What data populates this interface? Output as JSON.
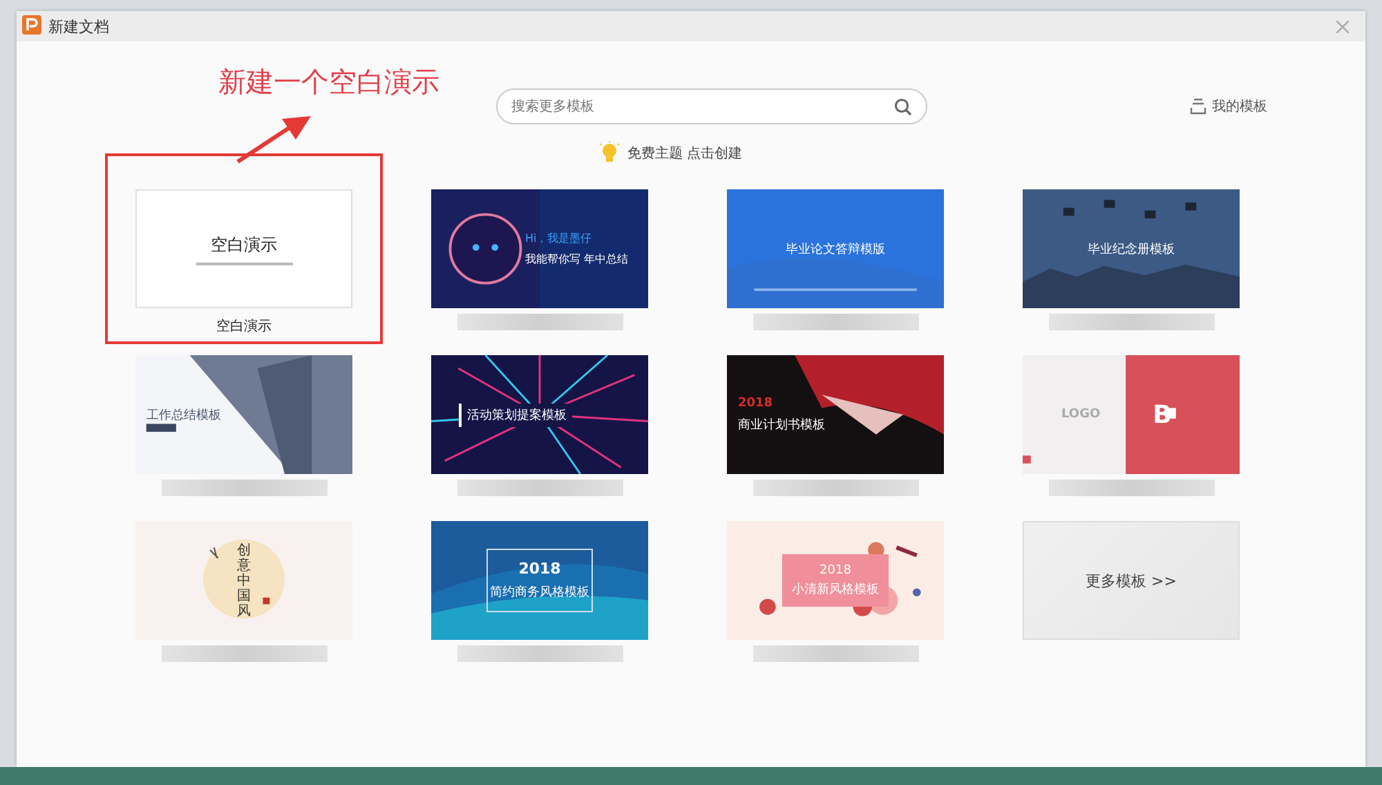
{
  "window": {
    "title": "新建文档"
  },
  "annotation": {
    "text": "新建一个空白演示"
  },
  "search": {
    "placeholder": "搜索更多模板"
  },
  "my_templates": "我的模板",
  "hint": "免费主题 点击创建",
  "cards": [
    {
      "kind": "blank",
      "title": "空白演示",
      "caption": "空白演示",
      "highlighted": true
    },
    {
      "kind": "template",
      "lines": [
        "Hi，我是墨仔",
        "我能帮你写 年中总结"
      ],
      "highlighted": false
    },
    {
      "kind": "template",
      "lines": [
        "毕业论文答辩模版"
      ],
      "highlighted": false
    },
    {
      "kind": "template",
      "lines": [
        "毕业纪念册模板"
      ],
      "highlighted": false
    },
    {
      "kind": "template",
      "lines": [
        "工作总结模板"
      ],
      "highlighted": false
    },
    {
      "kind": "template",
      "lines": [
        "活动策划提案模板"
      ],
      "highlighted": false
    },
    {
      "kind": "template",
      "lines": [
        "2018",
        "商业计划书模板"
      ],
      "highlighted": false
    },
    {
      "kind": "template",
      "lines": [
        "LOGO",
        "B"
      ],
      "highlighted": false
    },
    {
      "kind": "template",
      "lines": [
        "创意中国风"
      ],
      "highlighted": false
    },
    {
      "kind": "template",
      "lines": [
        "2018",
        "简约商务风格模板"
      ],
      "highlighted": false
    },
    {
      "kind": "template",
      "lines": [
        "2018",
        "小清新风格模板"
      ],
      "highlighted": false
    },
    {
      "kind": "more",
      "title": "更多模板 >>",
      "highlighted": false
    }
  ]
}
